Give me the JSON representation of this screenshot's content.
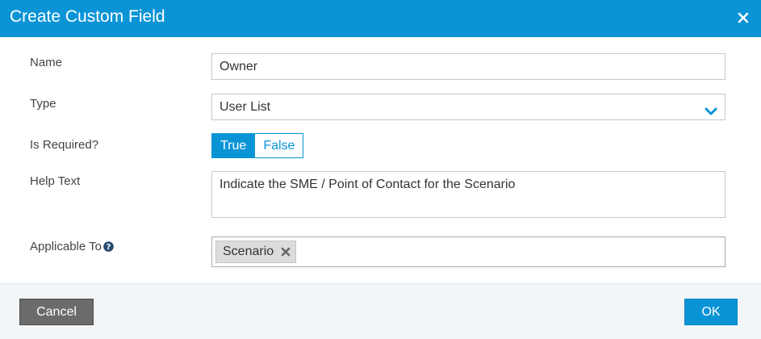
{
  "dialog": {
    "title": "Create Custom Field",
    "close_icon": "close-icon"
  },
  "form": {
    "name": {
      "label": "Name",
      "value": "Owner"
    },
    "type": {
      "label": "Type",
      "value": "User List",
      "icon": "chevron-down-icon"
    },
    "required": {
      "label": "Is Required?",
      "options": [
        "True",
        "False"
      ],
      "selected": "True"
    },
    "help_text": {
      "label": "Help Text",
      "value": "Indicate the SME / Point of Contact for the Scenario"
    },
    "applicable_to": {
      "label": "Applicable To",
      "help_icon": "question-circle-icon",
      "tags": [
        "Scenario"
      ],
      "tag_remove_icon": "remove-tag-icon"
    }
  },
  "footer": {
    "cancel_label": "Cancel",
    "ok_label": "OK"
  },
  "colors": {
    "accent": "#0a94d6",
    "cancel_button": "#6b6b6b",
    "footer_bg": "#f3f6f9"
  }
}
